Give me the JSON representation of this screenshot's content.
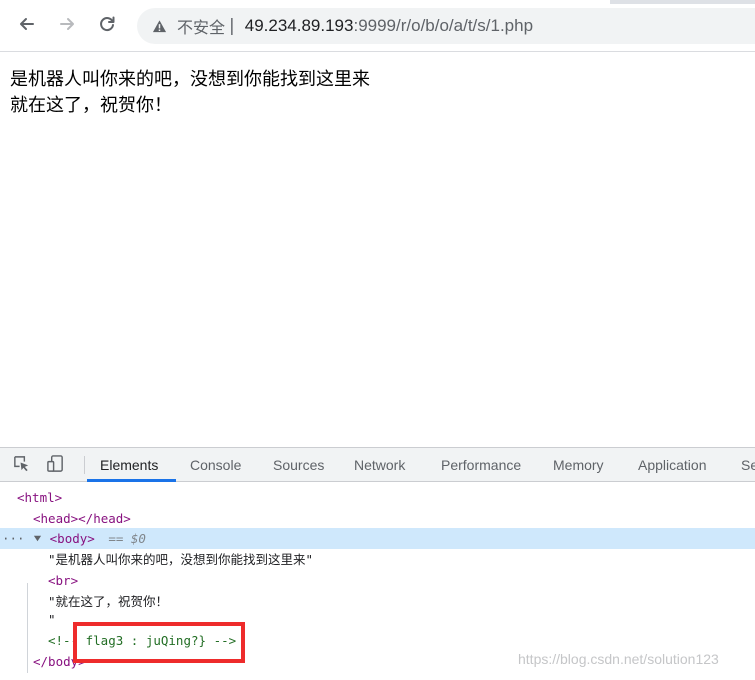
{
  "browser": {
    "url_security_label": "不安全",
    "url_separator": "|",
    "url_host": "49.234.89.193",
    "url_path": ":9999/r/o/b/o/a/t/s/1.php",
    "icons": [
      "back-arrow-icon",
      "forward-arrow-icon",
      "reload-icon",
      "warning-triangle-icon"
    ]
  },
  "page": {
    "line1": "是机器人叫你来的吧，没想到你能找到这里来",
    "line2": "就在这了，祝贺你！"
  },
  "devtools": {
    "tabs": [
      "Elements",
      "Console",
      "Sources",
      "Network",
      "Performance",
      "Memory",
      "Application",
      "Se"
    ],
    "active_tab": "Elements",
    "icons": [
      "inspect-element-icon",
      "device-toolbar-icon"
    ],
    "tree": {
      "html_open": "<html>",
      "head_line": "<head></head>",
      "body_ellipsis": "···",
      "body_open": "<body>",
      "body_eq": "== $0",
      "text1": "\"是机器人叫你来的吧，没想到你能找到这里来\"",
      "br": "<br>",
      "text2": "\"就在这了，祝贺你！",
      "text2_end": "\"",
      "comment": "<!-- flag3 : juQing?} -->",
      "body_close": "</body>"
    }
  },
  "watermark": "https://blog.csdn.net/solution123",
  "colors": {
    "accent": "#1a73e8",
    "highlight": "#ee2b2b",
    "tag": "#881280",
    "comment": "#236e25",
    "selection": "#cfe8fc"
  }
}
